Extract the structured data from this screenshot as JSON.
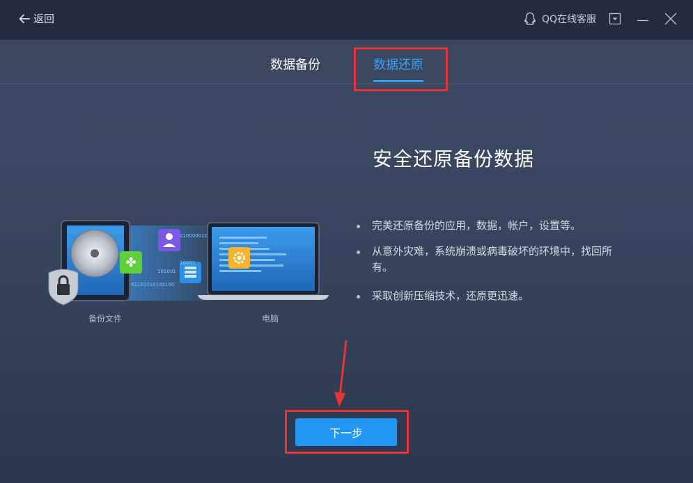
{
  "titlebar": {
    "back_label": "返回",
    "qq_label": "QQ在线客服"
  },
  "tabs": [
    {
      "label": "数据备份",
      "active": false
    },
    {
      "label": "数据还原",
      "active": true
    }
  ],
  "main": {
    "headline": "安全还原备份数据",
    "bullets": [
      "完美还原备份的应用，数据，帐户，设置等。",
      "从意外灾难，系统崩溃或病毒破坏的环境中，找回所有。",
      "采取创新压缩技术，还原更迅速。"
    ],
    "illustration": {
      "source_caption": "备份文件",
      "target_caption": "电脑",
      "binary_snippets": [
        "01000001010",
        "10001",
        "101001",
        "01101010100100"
      ]
    },
    "next_button": "下一步"
  },
  "colors": {
    "accent": "#2196f3",
    "active_tab": "#33a3ff",
    "highlight": "#e8333a",
    "titlebar_bg": "#222c3e"
  },
  "icons": [
    "back-arrow-icon",
    "qq-icon",
    "dropdown-icon",
    "minimize-icon",
    "close-icon"
  ]
}
